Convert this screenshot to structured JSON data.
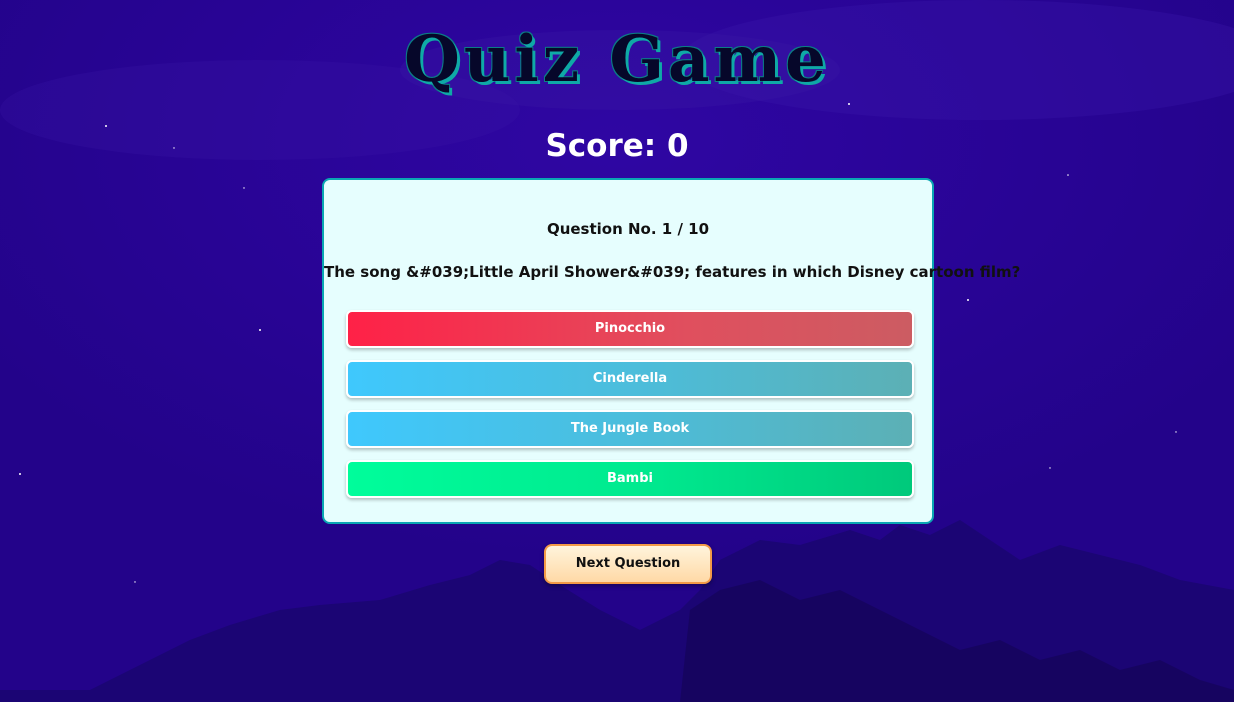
{
  "title": "Quiz Game",
  "score": {
    "label": "Score: 0"
  },
  "question": {
    "number_label": "Question No. 1 / 10",
    "text": "The song &#039;Little April Shower&#039; features in which Disney cartoon film?"
  },
  "options": [
    {
      "label": "Pinocchio",
      "color": "#ff2147"
    },
    {
      "label": "Cinderella",
      "color": "#3fc8fd"
    },
    {
      "label": "The Jungle Book",
      "color": "#3fc8fd"
    },
    {
      "label": "Bambi",
      "color": "#00fd9b"
    }
  ],
  "next_button": {
    "label": "Next Question"
  },
  "colors": {
    "background": "#26048f",
    "card": "#e6fefe",
    "card_border": "#0aa6b3",
    "title_outline": "#0fa9a6"
  }
}
